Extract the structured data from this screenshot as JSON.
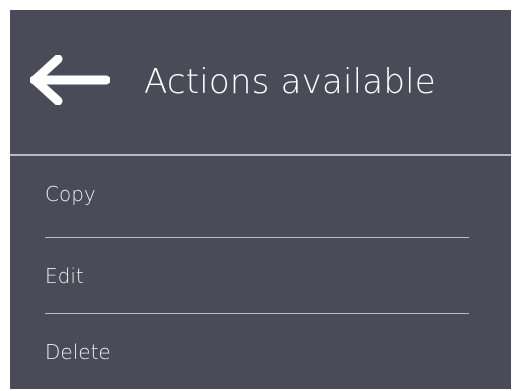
{
  "header": {
    "back_icon": "arrow-left-icon",
    "title": "Actions available"
  },
  "menu": {
    "items": [
      {
        "label": "Copy"
      },
      {
        "label": "Edit"
      },
      {
        "label": "Delete"
      }
    ]
  },
  "colors": {
    "panel_background": "#4a4b58",
    "text": "#ffffff",
    "divider": "#b9bac2"
  }
}
